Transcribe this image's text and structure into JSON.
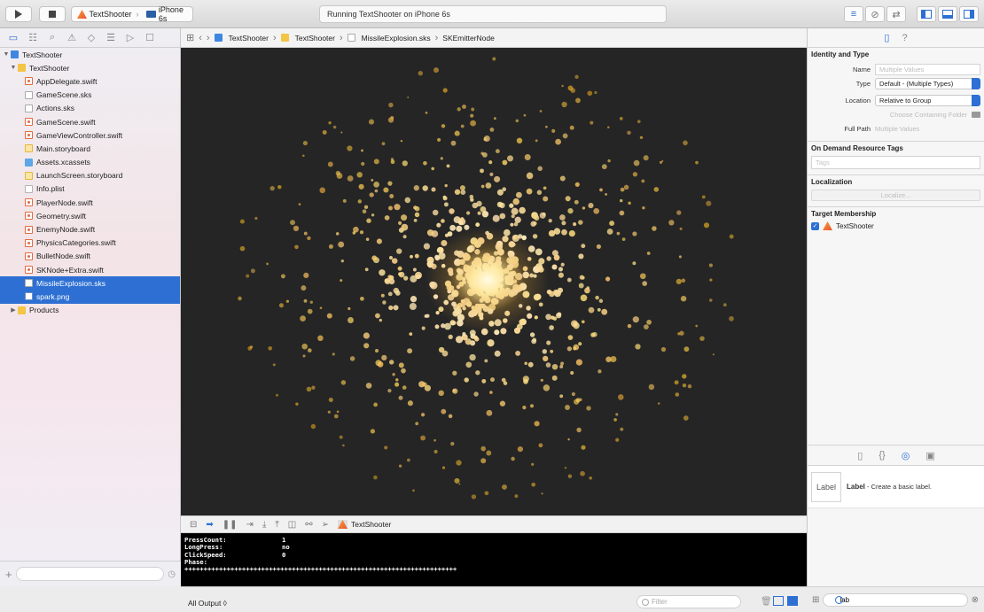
{
  "toolbar": {
    "scheme_name": "TextShooter",
    "device_name": "iPhone 6s",
    "activity_status": "Running TextShooter on iPhone 6s"
  },
  "navigator": {
    "filter_placeholder": "",
    "tree": [
      {
        "label": "TextShooter",
        "icon": "project-icon",
        "level": 0,
        "expanded": true
      },
      {
        "label": "TextShooter",
        "icon": "folder-icon",
        "level": 1,
        "expanded": true
      },
      {
        "label": "AppDelegate.swift",
        "icon": "swift-file-icon",
        "level": 2
      },
      {
        "label": "GameScene.sks",
        "icon": "spritekit-scene-icon",
        "level": 2
      },
      {
        "label": "Actions.sks",
        "icon": "spritekit-scene-icon",
        "level": 2
      },
      {
        "label": "GameScene.swift",
        "icon": "swift-file-icon",
        "level": 2
      },
      {
        "label": "GameViewController.swift",
        "icon": "swift-file-icon",
        "level": 2
      },
      {
        "label": "Main.storyboard",
        "icon": "storyboard-icon",
        "level": 2
      },
      {
        "label": "Assets.xcassets",
        "icon": "asset-catalog-icon",
        "level": 2
      },
      {
        "label": "LaunchScreen.storyboard",
        "icon": "storyboard-icon",
        "level": 2
      },
      {
        "label": "Info.plist",
        "icon": "plist-icon",
        "level": 2
      },
      {
        "label": "PlayerNode.swift",
        "icon": "swift-file-icon",
        "level": 2
      },
      {
        "label": "Geometry.swift",
        "icon": "swift-file-icon",
        "level": 2
      },
      {
        "label": "EnemyNode.swift",
        "icon": "swift-file-icon",
        "level": 2
      },
      {
        "label": "PhysicsCategories.swift",
        "icon": "swift-file-icon",
        "level": 2
      },
      {
        "label": "BulletNode.swift",
        "icon": "swift-file-icon",
        "level": 2
      },
      {
        "label": "SKNode+Extra.swift",
        "icon": "swift-file-icon",
        "level": 2
      },
      {
        "label": "MissileExplosion.sks",
        "icon": "particle-file-icon",
        "level": 2,
        "selected": true
      },
      {
        "label": "spark.png",
        "icon": "image-file-icon",
        "level": 2,
        "selected": true
      },
      {
        "label": "Products",
        "icon": "folder-icon",
        "level": 1,
        "expanded": false
      }
    ]
  },
  "jumpbar": {
    "crumbs": [
      "TextShooter",
      "TextShooter",
      "MissileExplosion.sks",
      "SKEmitterNode"
    ]
  },
  "debug": {
    "target": "TextShooter",
    "console_lines": [
      {
        "key": "PressCount:",
        "value": "1"
      },
      {
        "key": "LongPress:",
        "value": "no"
      },
      {
        "key": "ClickSpeed:",
        "value": "0"
      },
      {
        "key": "Phase:",
        "value": ""
      }
    ],
    "separator": "+++++++++++++++++++++++++++++++++++++++++++++++++++++++++++++++++++++++",
    "output_selector": "All Output ◊",
    "filter_placeholder": "Filter"
  },
  "inspector": {
    "identity_title": "Identity and Type",
    "name_label": "Name",
    "name_placeholder": "Multiple Values",
    "type_label": "Type",
    "type_value": "Default - (Multiple Types)",
    "location_label": "Location",
    "location_value": "Relative to Group",
    "choose_folder": "Choose Containing Folder",
    "fullpath_label": "Full Path",
    "fullpath_value": "Multiple Values",
    "odr_title": "On Demand Resource Tags",
    "tags_placeholder": "Tags",
    "localization_title": "Localization",
    "localize_button": "Localize...",
    "membership_title": "Target Membership",
    "membership_target": "TextShooter",
    "membership_checked": true
  },
  "library": {
    "thumb_text": "Label",
    "item_title": "Label",
    "item_desc": " - Create a basic label.",
    "search_value": "lab"
  },
  "colors": {
    "accent": "#2d6fd3",
    "canvas_bg": "#252526",
    "particle_core": "#fff4c8",
    "particle": "#f0b43a"
  }
}
